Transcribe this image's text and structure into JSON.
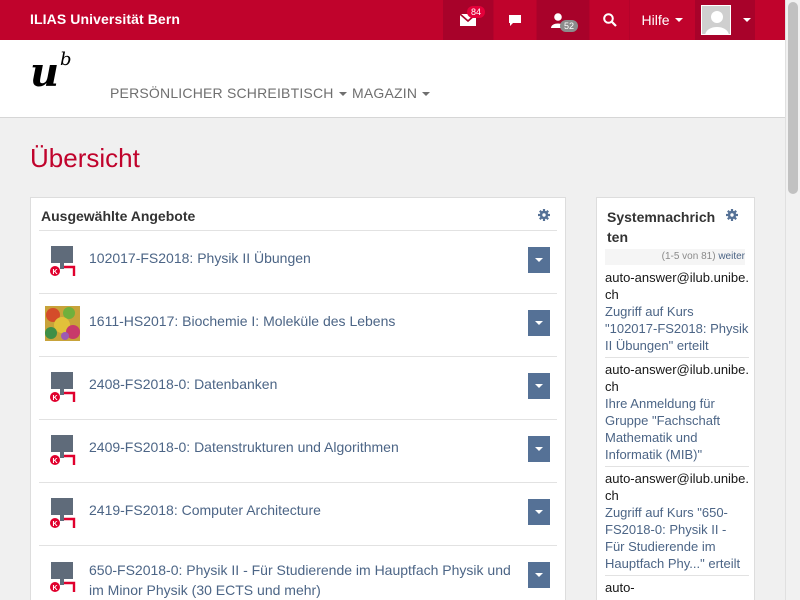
{
  "topbar": {
    "brand": "ILIAS Universität Bern",
    "mail_badge": "84",
    "contacts_badge": "52",
    "help_label": "Hilfe",
    "mail_icon": "envelope-icon",
    "chat_icon": "speech-bubble-icon",
    "contacts_icon": "user-icon",
    "search_icon": "magnifier-icon",
    "accent": "#c0032c"
  },
  "header": {
    "logo_u": "u",
    "logo_b": "b",
    "nav": [
      "PERSÖNLICHER SCHREIBTISCH",
      "MAGAZIN"
    ]
  },
  "page_title": "Übersicht",
  "selected_offers": {
    "title": "Ausgewählte Angebote",
    "items": [
      {
        "title": "102017-FS2018: Physik II Übungen",
        "icon": "course-icon"
      },
      {
        "title": "1611-HS2017: Biochemie I: Moleküle des Lebens",
        "icon": "course-thumbnail-image"
      },
      {
        "title": "2408-FS2018-0: Datenbanken",
        "icon": "course-icon"
      },
      {
        "title": "2409-FS2018-0: Datenstrukturen und Algorithmen",
        "icon": "course-icon"
      },
      {
        "title": "2419-FS2018: Computer Architecture",
        "icon": "course-icon"
      },
      {
        "title": "650-FS2018-0: Physik II - Für Studierende im Hauptfach Physik und im Minor Physik (30 ECTS und mehr)",
        "icon": "course-icon"
      }
    ]
  },
  "system_messages": {
    "title": "Systemnachrichten",
    "title_line1": "Systemnachrich",
    "title_line2": "ten",
    "pager": "(1-5 von 81)",
    "next": "weiter",
    "messages": [
      {
        "from": "auto-answer@ilub.unibe.ch",
        "text": "Zugriff auf Kurs \"102017-FS2018: Physik II Übungen\" erteilt"
      },
      {
        "from": "auto-answer@ilub.unibe.ch",
        "text": "Ihre Anmeldung für Gruppe \"Fachschaft Mathematik und Informatik (MIB)\""
      },
      {
        "from": "auto-answer@ilub.unibe.ch",
        "text": "Zugriff auf Kurs \"650-FS2018-0: Physik II - Für Studierende im Hauptfach Phy...\" erteilt"
      },
      {
        "from": "auto-",
        "text": ""
      }
    ]
  }
}
